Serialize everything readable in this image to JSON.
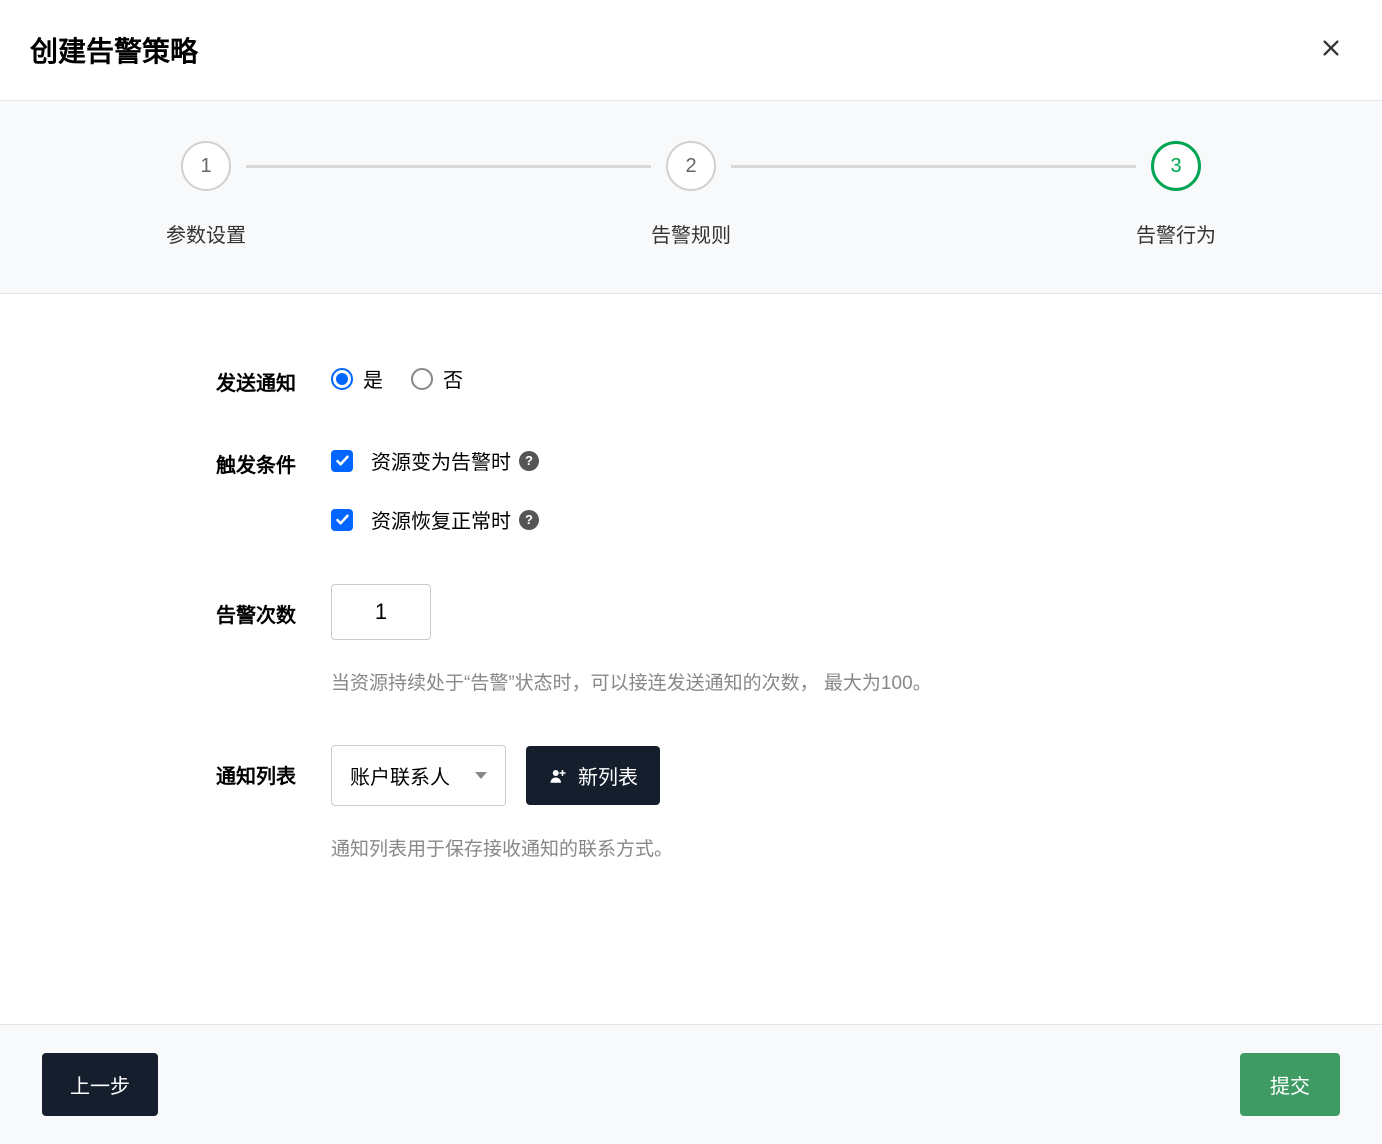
{
  "header": {
    "title": "创建告警策略"
  },
  "steps": {
    "items": [
      {
        "num": "1",
        "label": "参数设置"
      },
      {
        "num": "2",
        "label": "告警规则"
      },
      {
        "num": "3",
        "label": "告警行为"
      }
    ]
  },
  "form": {
    "sendNotification": {
      "label": "发送通知",
      "yes": "是",
      "no": "否"
    },
    "triggerCondition": {
      "label": "触发条件",
      "option1": "资源变为告警时",
      "option2": "资源恢复正常时"
    },
    "alarmCount": {
      "label": "告警次数",
      "value": "1",
      "hint": "当资源持续处于“告警”状态时，可以接连发送通知的次数， 最大为100。"
    },
    "notificationList": {
      "label": "通知列表",
      "selected": "账户联系人",
      "newListBtn": "新列表",
      "hint": "通知列表用于保存接收通知的联系方式。"
    }
  },
  "footer": {
    "prev": "上一步",
    "submit": "提交"
  }
}
